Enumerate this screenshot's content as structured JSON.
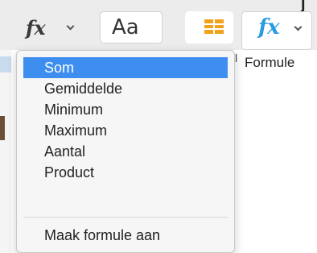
{
  "toolbar": {
    "text_style_label": "Aa",
    "formula_label": "Formule",
    "stray_label": "l",
    "top_right_glyph": "j"
  },
  "menu": {
    "items": [
      {
        "label": "Som",
        "selected": true
      },
      {
        "label": "Gemiddelde"
      },
      {
        "label": "Minimum"
      },
      {
        "label": "Maximum"
      },
      {
        "label": "Aantal"
      },
      {
        "label": "Product"
      }
    ],
    "create_formula": "Maak formule aan"
  },
  "colors": {
    "selection": "#3e8ef0",
    "formula_icon": "#2a9be0",
    "table_icon": "#f0a21c"
  }
}
